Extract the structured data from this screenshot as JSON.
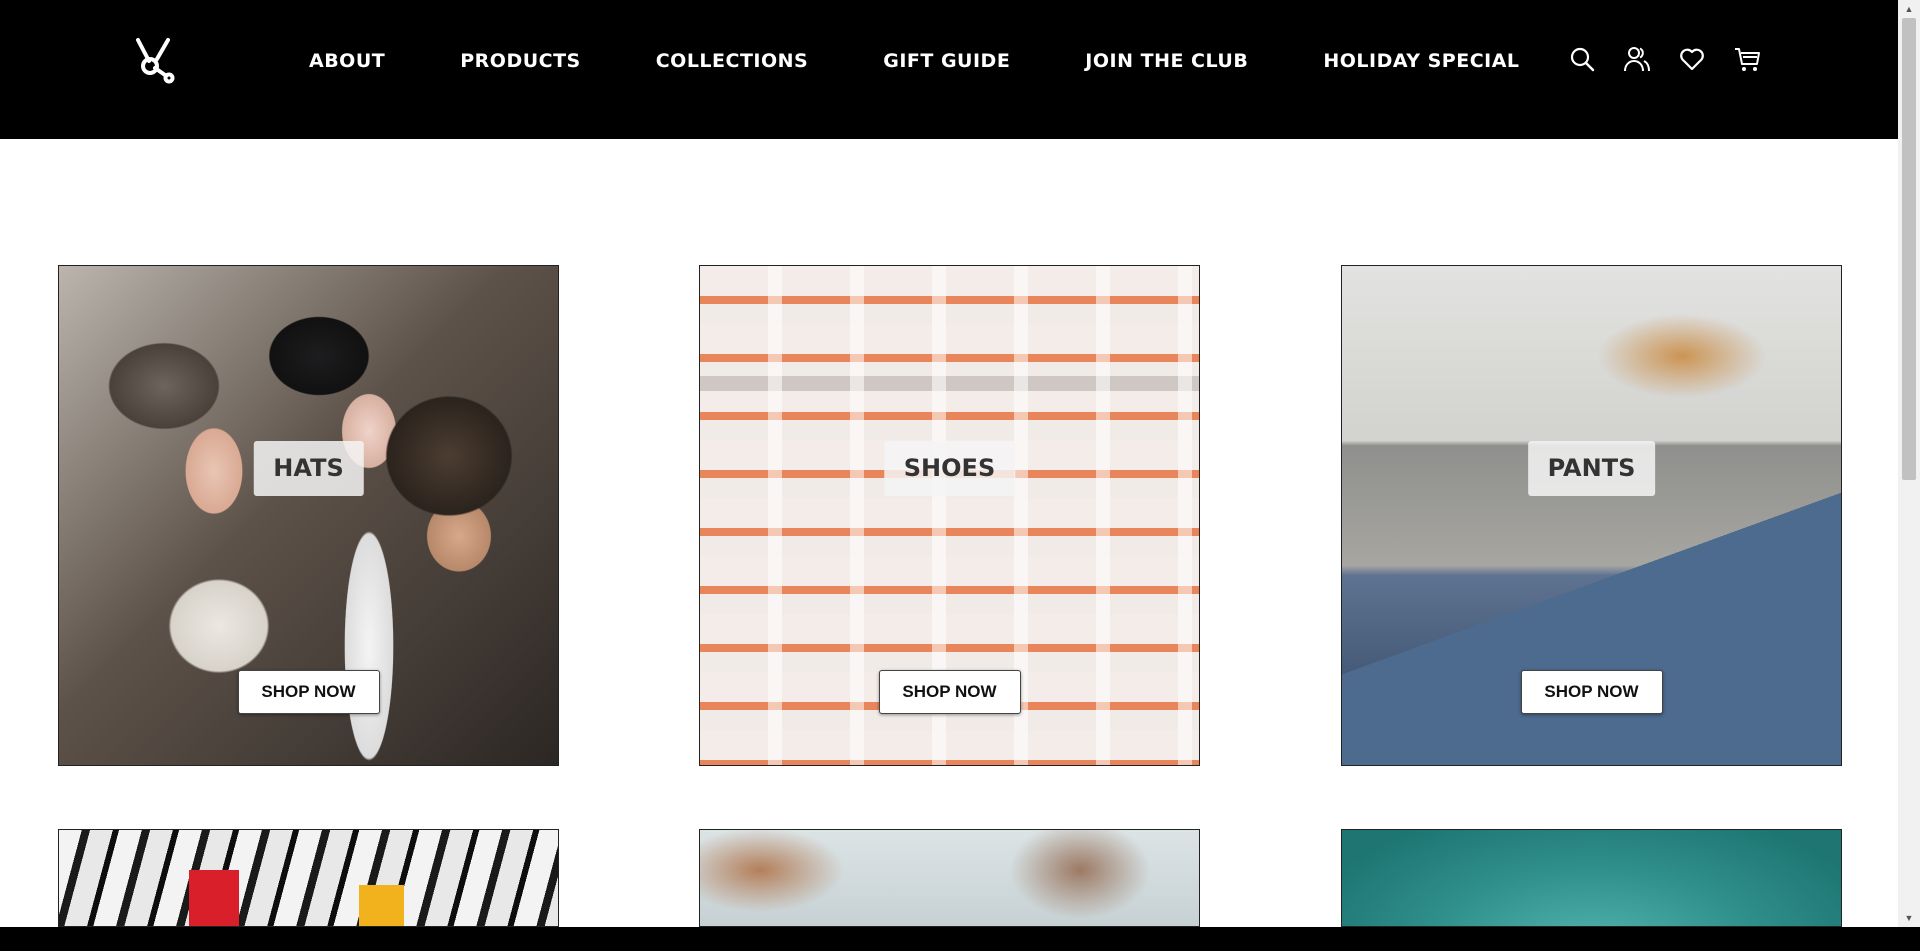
{
  "brand": {
    "logo_icon": "molecule-logo-icon"
  },
  "nav": {
    "items": [
      {
        "label": "ABOUT"
      },
      {
        "label": "PRODUCTS"
      },
      {
        "label": "COLLECTIONS"
      },
      {
        "label": "GIFT GUIDE"
      },
      {
        "label": "JOIN THE CLUB"
      },
      {
        "label": "HOLIDAY SPECIAL"
      }
    ]
  },
  "header_actions": [
    {
      "icon": "search-icon"
    },
    {
      "icon": "account-icon"
    },
    {
      "icon": "wishlist-heart-icon"
    },
    {
      "icon": "cart-icon"
    }
  ],
  "categories": [
    {
      "label": "HATS",
      "button_label": "SHOP NOW"
    },
    {
      "label": "SHOES",
      "button_label": "SHOP NOW"
    },
    {
      "label": "PANTS",
      "button_label": "SHOP NOW"
    }
  ],
  "colors": {
    "header_bg": "#000000",
    "header_text": "#ffffff",
    "page_bg": "#ffffff",
    "label_bg": "#f5f5f5"
  }
}
